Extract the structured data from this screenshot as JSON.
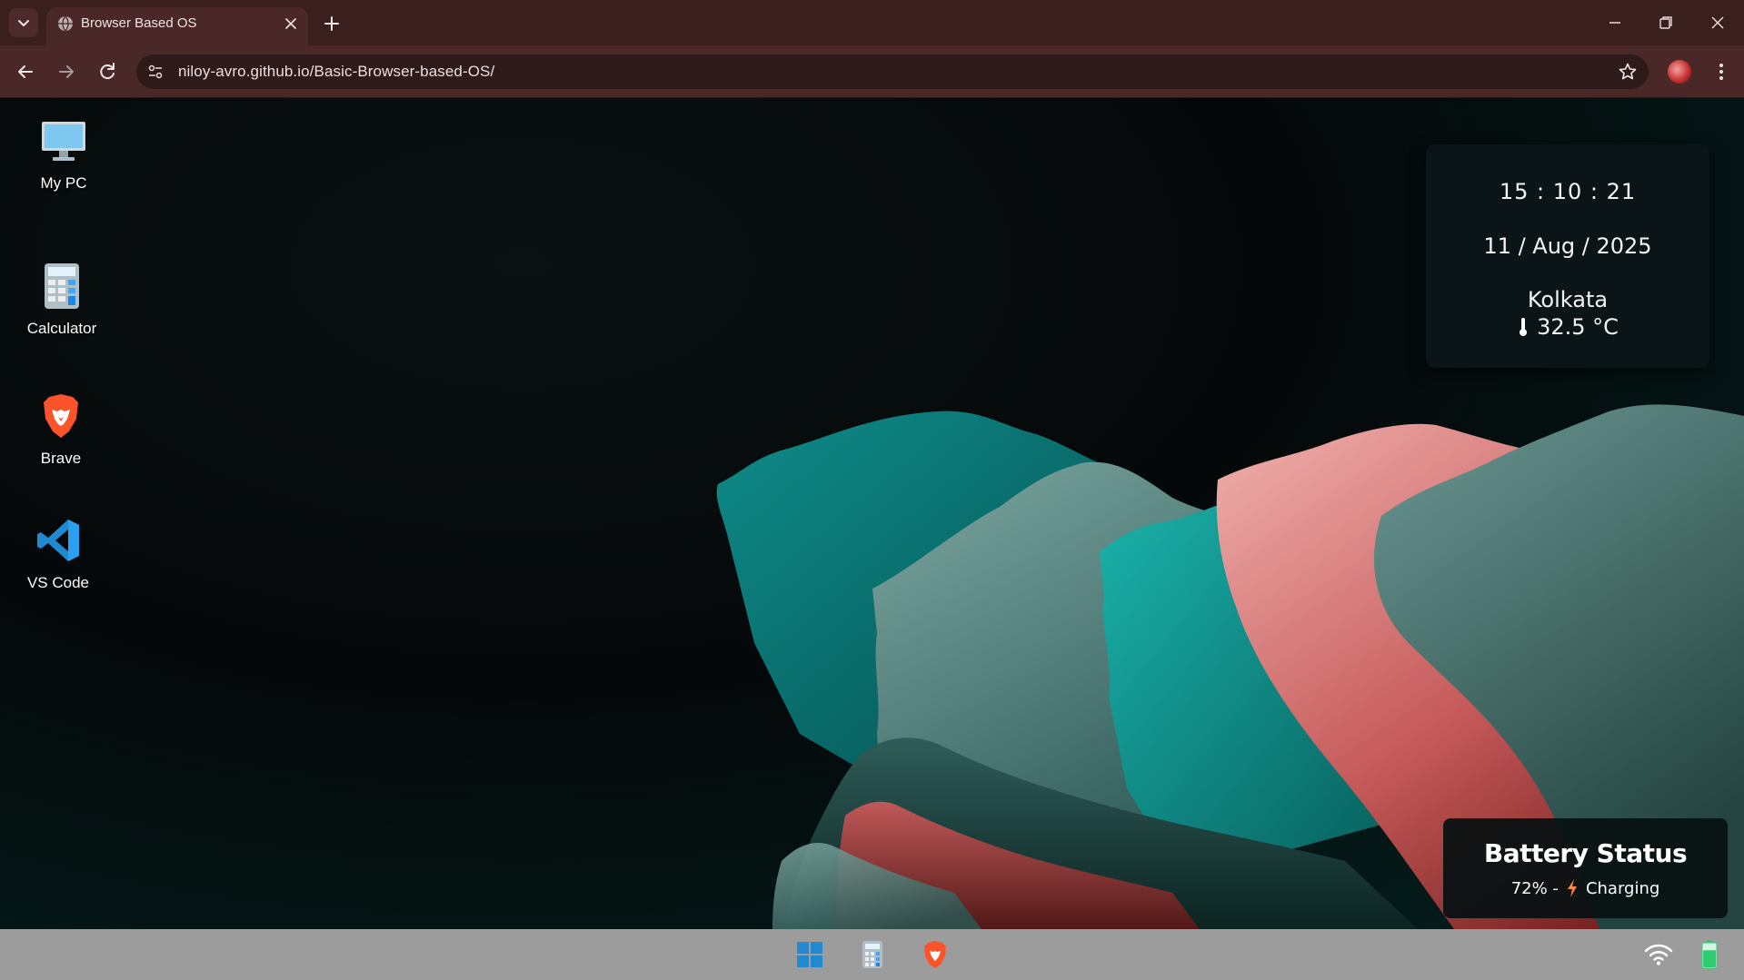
{
  "browser": {
    "tab_title": "Browser Based OS",
    "url": "niloy-avro.github.io/Basic-Browser-based-OS/",
    "accent_color": "#4a2828"
  },
  "desktop": {
    "icons": [
      {
        "label": "My PC",
        "icon": "monitor-icon"
      },
      {
        "label": "Calculator",
        "icon": "calculator-icon"
      },
      {
        "label": "Brave",
        "icon": "brave-lion-icon"
      },
      {
        "label": "VS Code",
        "icon": "vscode-icon"
      }
    ]
  },
  "clock_widget": {
    "time": "15 : 10 : 21",
    "date": "11 / Aug / 2025",
    "city": "Kolkata",
    "temperature": "32.5 °C"
  },
  "battery_widget": {
    "title": "Battery Status",
    "percent": "72% -",
    "state": "Charging",
    "level_fraction": 0.72
  },
  "taskbar": {
    "items": [
      "windows-start-icon",
      "calculator-icon",
      "brave-lion-icon"
    ],
    "tray": [
      "wifi-icon",
      "battery-icon"
    ],
    "background": "#9c9c9c"
  }
}
